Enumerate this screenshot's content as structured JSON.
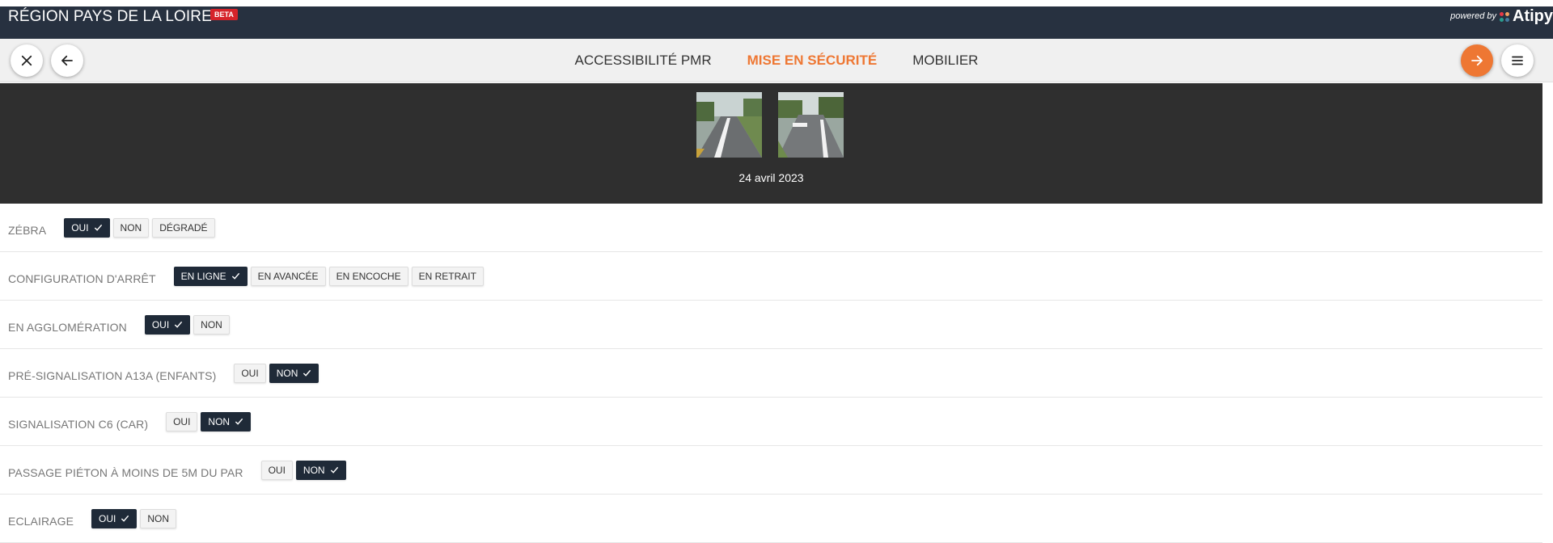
{
  "header": {
    "title": "RÉGION PAYS DE LA LOIRE",
    "badge": "BETA",
    "powered_by": "powered by",
    "brand_name": "Atipy",
    "background_color": "#273140",
    "badge_color": "#d6232a"
  },
  "toolbar": {
    "close_icon": "close-icon",
    "back_icon": "arrow-left-icon",
    "next_icon": "arrow-right-icon",
    "menu_icon": "hamburger-menu-icon",
    "accent_color": "#ee7733"
  },
  "tabs": [
    {
      "label": "ACCESSIBILITÉ PMR",
      "active": false
    },
    {
      "label": "MISE EN SÉCURITÉ",
      "active": true
    },
    {
      "label": "MOBILIER",
      "active": false
    }
  ],
  "gallery": {
    "date": "24 avril 2023",
    "photos": [
      {
        "name": "photo-road-1"
      },
      {
        "name": "photo-road-2"
      }
    ]
  },
  "form": {
    "rows": [
      {
        "label": "ZÉBRA",
        "options": [
          {
            "label": "OUI",
            "selected": true
          },
          {
            "label": "NON",
            "selected": false
          },
          {
            "label": "DÉGRADÉ",
            "selected": false
          }
        ]
      },
      {
        "label": "CONFIGURATION D'ARRÊT",
        "options": [
          {
            "label": "EN LIGNE",
            "selected": true
          },
          {
            "label": "EN AVANCÉE",
            "selected": false
          },
          {
            "label": "EN ENCOCHE",
            "selected": false
          },
          {
            "label": "EN RETRAIT",
            "selected": false
          }
        ]
      },
      {
        "label": "EN AGGLOMÉRATION",
        "options": [
          {
            "label": "OUI",
            "selected": true
          },
          {
            "label": "NON",
            "selected": false
          }
        ]
      },
      {
        "label": "PRÉ-SIGNALISATION A13A (ENFANTS)",
        "options": [
          {
            "label": "OUI",
            "selected": false
          },
          {
            "label": "NON",
            "selected": true
          }
        ]
      },
      {
        "label": "SIGNALISATION C6 (CAR)",
        "options": [
          {
            "label": "OUI",
            "selected": false
          },
          {
            "label": "NON",
            "selected": true
          }
        ]
      },
      {
        "label": "PASSAGE PIÉTON À MOINS DE 5M DU PAR",
        "options": [
          {
            "label": "OUI",
            "selected": false
          },
          {
            "label": "NON",
            "selected": true
          }
        ]
      },
      {
        "label": "ECLAIRAGE",
        "options": [
          {
            "label": "OUI",
            "selected": true
          },
          {
            "label": "NON",
            "selected": false
          }
        ]
      }
    ]
  }
}
